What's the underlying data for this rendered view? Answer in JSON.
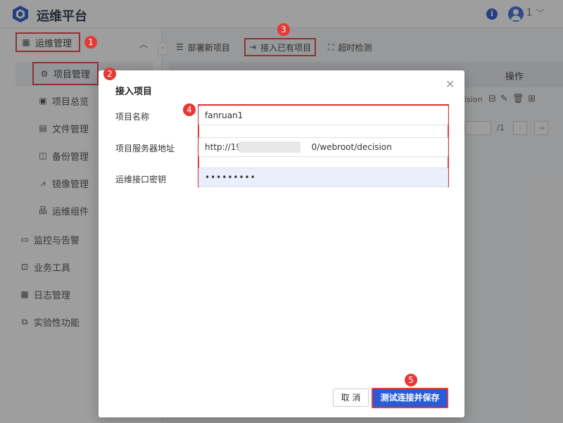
{
  "app": {
    "title": "运维平台",
    "user_name": "1"
  },
  "sidebar": {
    "top_item": "运维管理",
    "active_sub": "项目管理",
    "sub_items": [
      "项目总览",
      "文件管理",
      "备份管理",
      "镜像管理",
      "运维组件"
    ],
    "groups": [
      "监控与告警",
      "业务工具",
      "日志管理",
      "实验性功能"
    ]
  },
  "toolbar": {
    "deploy_label": "部署新项目",
    "connect_label": "接入已有项目",
    "timeout_label": "超时检测"
  },
  "table": {
    "ops_header": "操作",
    "decision_peek": "ision",
    "page_total": "/1"
  },
  "modal": {
    "title": "接入项目",
    "labels": {
      "name": "项目名称",
      "server": "项目服务器地址",
      "secret": "运维接口密钥"
    },
    "values": {
      "name": "fanruan1",
      "server_prefix": "http://192",
      "server_suffix": "0/webroot/decision",
      "secret": "•••••••••"
    },
    "cancel_label": "取 消",
    "save_label": "测试连接并保存"
  },
  "badges": [
    "1",
    "2",
    "3",
    "4",
    "5"
  ],
  "colors": {
    "accent": "#2a5bd7",
    "highlight": "#e03c3c",
    "badge": "#e53935"
  }
}
